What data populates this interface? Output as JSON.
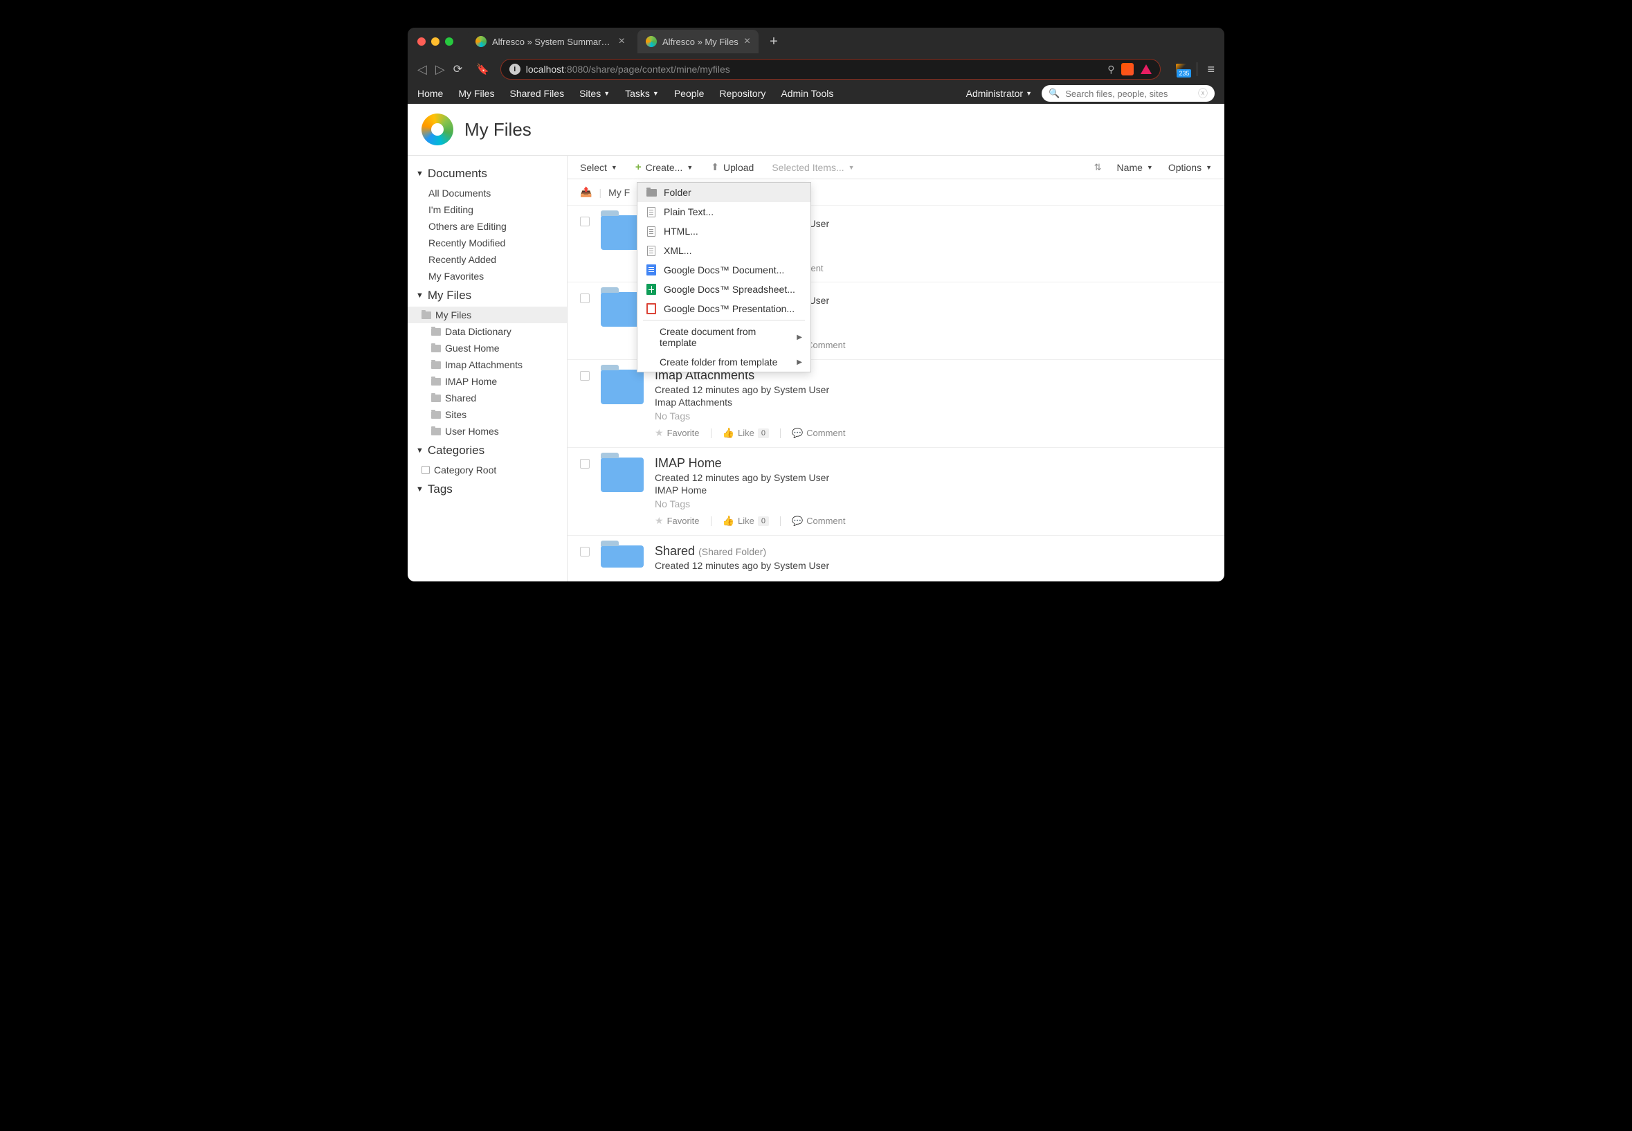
{
  "browser": {
    "tabs": [
      {
        "title": "Alfresco » System Summary [Hos"
      },
      {
        "title": "Alfresco » My Files"
      }
    ],
    "url_host": "localhost",
    "url_port": ":8080",
    "url_path": "/share/page/context/mine/myfiles",
    "rss_count": "235"
  },
  "topnav": {
    "items": [
      "Home",
      "My Files",
      "Shared Files",
      "Sites",
      "Tasks",
      "People",
      "Repository",
      "Admin Tools"
    ],
    "user": "Administrator",
    "search_placeholder": "Search files, people, sites"
  },
  "page": {
    "title": "My Files"
  },
  "sidebar": {
    "documents": {
      "heading": "Documents",
      "items": [
        "All Documents",
        "I'm Editing",
        "Others are Editing",
        "Recently Modified",
        "Recently Added",
        "My Favorites"
      ]
    },
    "myfiles": {
      "heading": "My Files",
      "root": "My Files",
      "folders": [
        "Data Dictionary",
        "Guest Home",
        "Imap Attachments",
        "IMAP Home",
        "Shared",
        "Sites",
        "User Homes"
      ]
    },
    "categories": {
      "heading": "Categories",
      "root": "Category Root"
    },
    "tags": {
      "heading": "Tags"
    }
  },
  "toolbar": {
    "select": "Select",
    "create": "Create...",
    "upload": "Upload",
    "selected": "Selected Items...",
    "name": "Name",
    "options": "Options"
  },
  "breadcrumb": {
    "item": "My F"
  },
  "create_menu": {
    "folder": "Folder",
    "plaintext": "Plain Text...",
    "html": "HTML...",
    "xml": "XML...",
    "gdoc": "Google Docs™ Document...",
    "gsheet": "Google Docs™ Spreadsheet...",
    "gslides": "Google Docs™ Presentation...",
    "doc_template": "Create document from template",
    "folder_template": "Create folder from template"
  },
  "labels": {
    "no_tags": "No Tags",
    "favorite": "Favorite",
    "like": "Like",
    "comment": "Comment",
    "like_count": "0"
  },
  "files": [
    {
      "name": "",
      "meta_suffix": "ystem User",
      "desc": "",
      "no_tags": ""
    },
    {
      "name": "",
      "meta_suffix": "ystem User",
      "desc": "",
      "no_tags": "No Tags"
    },
    {
      "name": "Imap Attachments",
      "meta": "Created 12 minutes ago by System User",
      "desc": "Imap Attachments",
      "no_tags": "No Tags"
    },
    {
      "name": "IMAP Home",
      "meta": "Created 12 minutes ago by System User",
      "desc": "IMAP Home",
      "no_tags": "No Tags"
    },
    {
      "name": "Shared",
      "subtype": "(Shared Folder)",
      "meta": "Created 12 minutes ago by System User"
    }
  ]
}
